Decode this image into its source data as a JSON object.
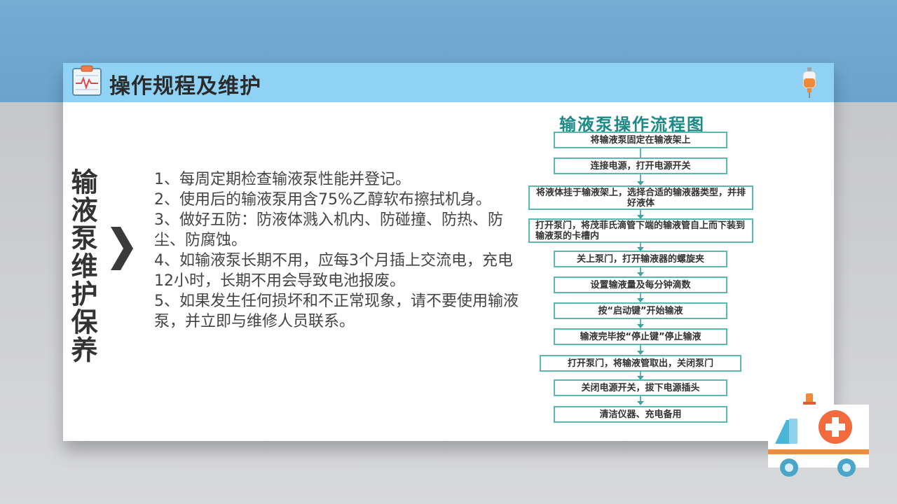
{
  "header": {
    "title": "操作规程及维护"
  },
  "side_title": "输液泵维护保养",
  "maintenance_items": [
    "1、每周定期检查输液泵性能并登记。",
    "2、使用后的输液泵用含75%乙醇软布擦拭机身。",
    "3、做好五防：防液体溅入机内、防碰撞、防热、防尘、防腐蚀。",
    "4、如输液泵长期不用，应每3个月插上交流电，充电12小时，长期不用会导致电池报废。",
    "5、如果发生任何损坏和不正常现象，请不要使用输液泵，并立即与维修人员联系。"
  ],
  "flowchart": {
    "title": "输液泵操作流程图",
    "steps": [
      "将输液泵固定在输液架上",
      "连接电源，打开电源开关",
      "将液体挂于输液架上，选择合适的输液器类型，并排好液体",
      "打开泵门，将茂菲氏滴管下端的输液管自上而下装到输液泵的卡槽内",
      "关上泵门，打开输液器的螺旋夹",
      "设置输液量及每分钟滴数",
      "按“启动键”开始输液",
      "输液完毕按“停止键”停止输液",
      "打开泵门，将输液管取出，关闭泵门",
      "关闭电源开关，拔下电源插头",
      "清洁仪器、充电备用"
    ]
  },
  "colors": {
    "header_bg": "#8fd2f3",
    "top_band": "#74acd3",
    "flow_accent": "#1c8a86",
    "ambulance_cross": "#f26a3d"
  },
  "icons": {
    "header": "clipboard-heartbeat-icon",
    "drip": "iv-drip-icon",
    "chevron": "chevron-right-icon",
    "ambulance": "ambulance-icon"
  }
}
